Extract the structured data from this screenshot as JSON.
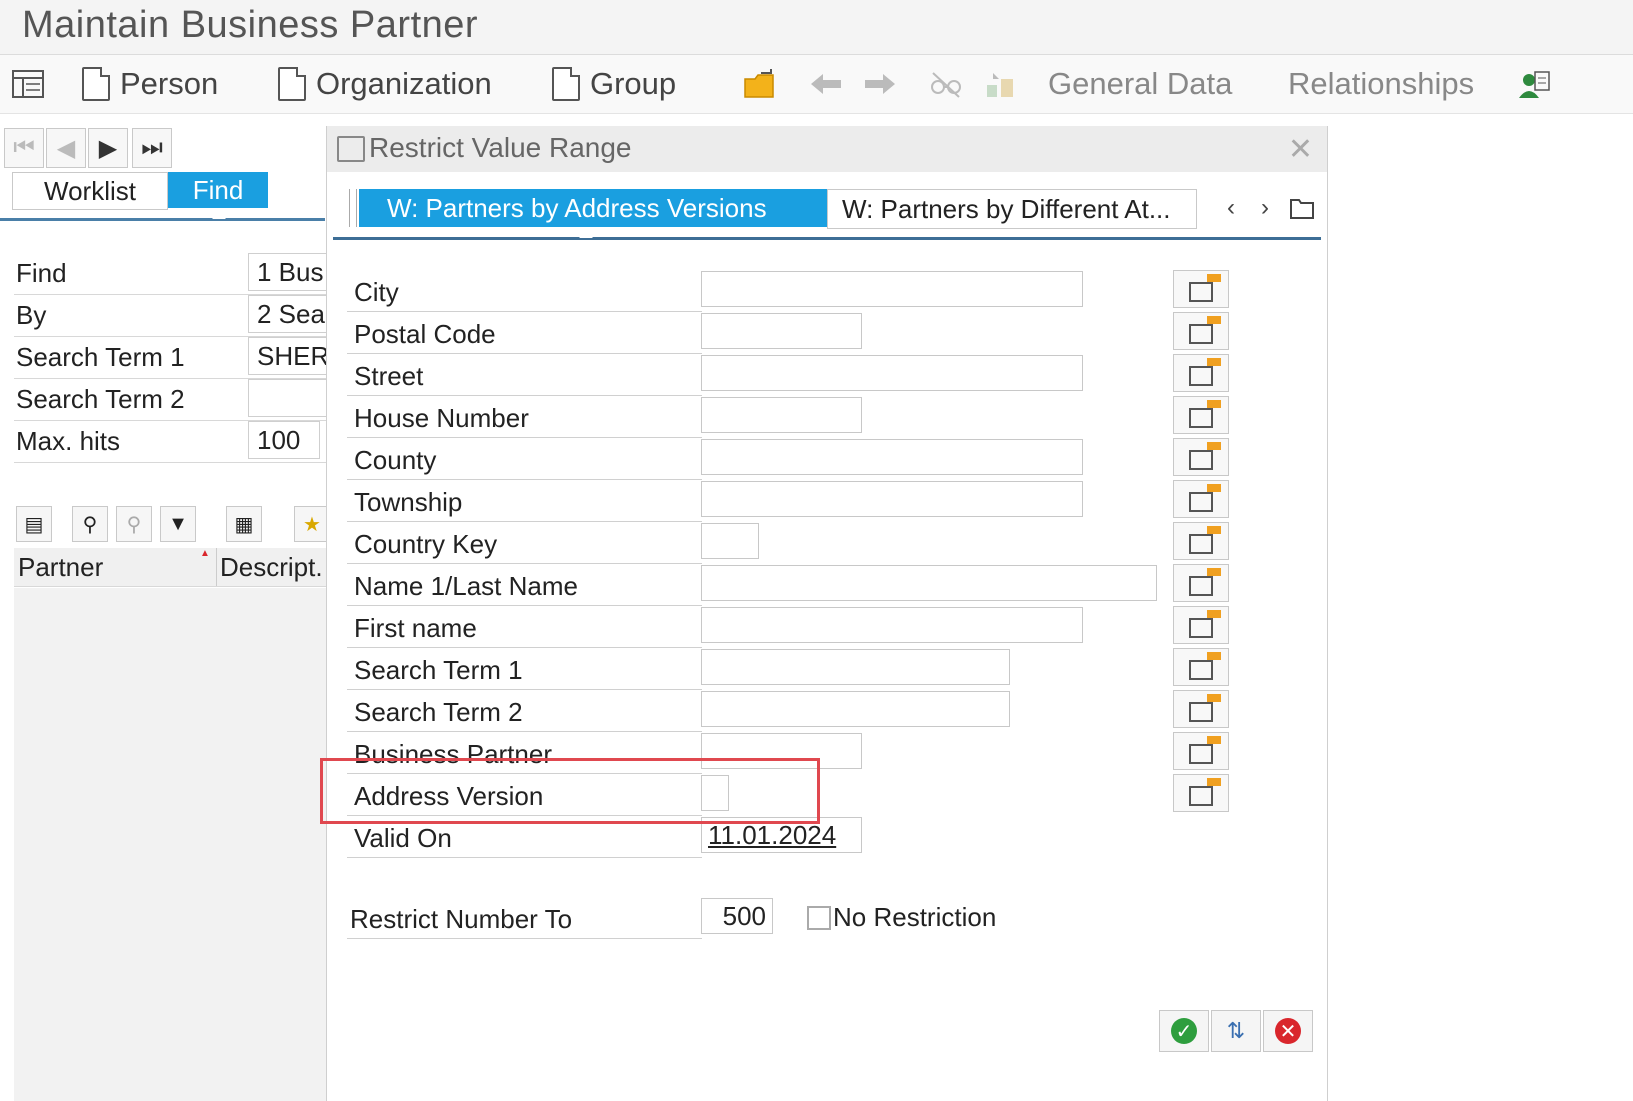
{
  "window": {
    "title": "Maintain Business Partner"
  },
  "toolbar": {
    "person": "Person",
    "organization": "Organization",
    "group": "Group",
    "general_data": "General Data",
    "relationships": "Relationships"
  },
  "left_panel": {
    "tabs": [
      {
        "label": "Worklist"
      },
      {
        "label": "Find",
        "active": true
      }
    ],
    "fields": [
      {
        "label": "Find",
        "value": "1 Bus"
      },
      {
        "label": "By",
        "value": "2 Sea"
      },
      {
        "label": "Search Term 1",
        "value": "SHERR"
      },
      {
        "label": "Search Term 2",
        "value": ""
      },
      {
        "label": "Max. hits",
        "value": "100"
      }
    ],
    "grid": {
      "columns": [
        "Partner",
        "Descript."
      ]
    }
  },
  "dialog": {
    "title": "Restrict Value Range",
    "tabs": [
      {
        "label": "W: Partners by Address Versions",
        "active": true
      },
      {
        "label": "W: Partners by Different At..."
      }
    ],
    "fields": [
      {
        "label": "City",
        "value": ""
      },
      {
        "label": "Postal Code",
        "value": ""
      },
      {
        "label": "Street",
        "value": ""
      },
      {
        "label": "House Number",
        "value": ""
      },
      {
        "label": "County",
        "value": ""
      },
      {
        "label": "Township",
        "value": ""
      },
      {
        "label": "Country Key",
        "value": ""
      },
      {
        "label": "Name 1/Last Name",
        "value": ""
      },
      {
        "label": "First name",
        "value": ""
      },
      {
        "label": "Search Term 1",
        "value": ""
      },
      {
        "label": "Search Term 2",
        "value": ""
      },
      {
        "label": "Business Partner",
        "value": ""
      },
      {
        "label": "Address Version",
        "value": ""
      },
      {
        "label": "Valid On",
        "value": "11.01.2024"
      }
    ],
    "restrict_number_label": "Restrict Number To",
    "restrict_number_value": "500",
    "no_restriction_label": "No Restriction",
    "no_restriction_checked": false
  },
  "colors": {
    "accent": "#1a9fe0",
    "highlight": "#e0484f",
    "ok": "#2e9e3e",
    "cancel": "#d9262c"
  }
}
